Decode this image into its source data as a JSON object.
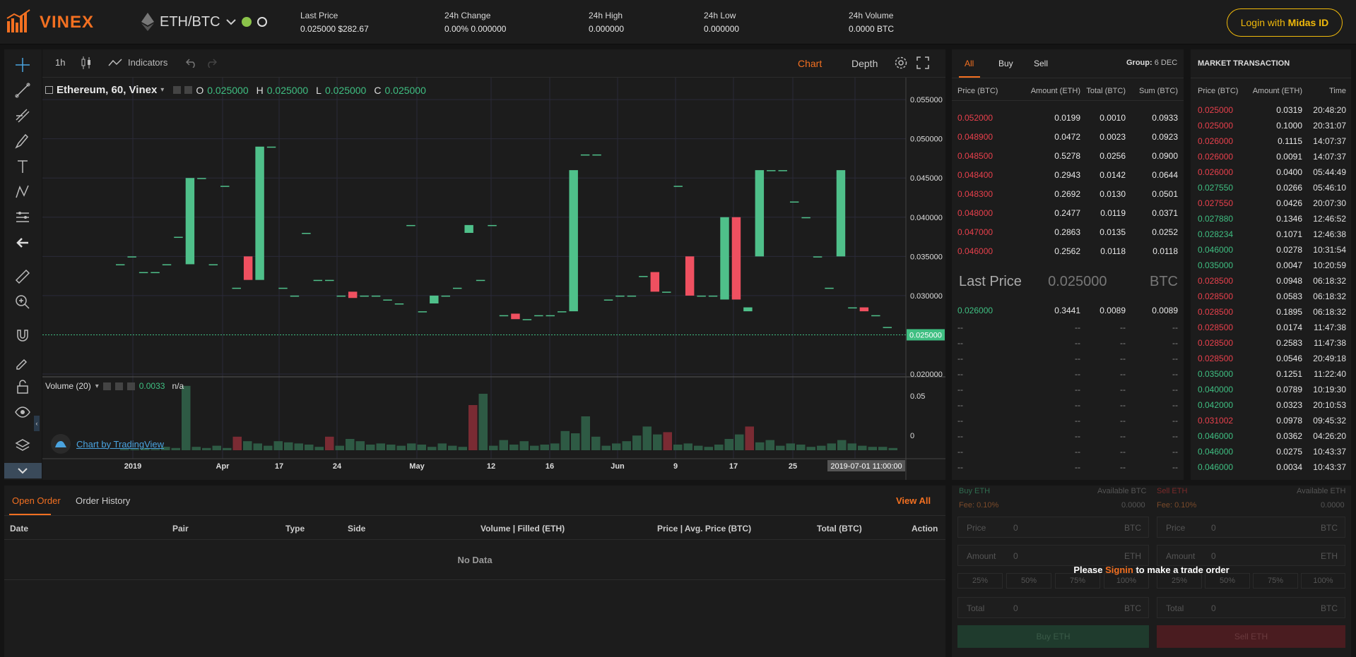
{
  "header": {
    "brand": "VINEX",
    "pair": "ETH/BTC",
    "stats": [
      {
        "label": "Last Price",
        "value": "0.025000 $282.67"
      },
      {
        "label": "24h Change",
        "value": "0.00% 0.000000"
      },
      {
        "label": "24h High",
        "value": "0.000000"
      },
      {
        "label": "24h Low",
        "value": "0.000000"
      },
      {
        "label": "24h Volume",
        "value": "0.0000 BTC"
      }
    ],
    "login_prefix": "Login with ",
    "login_brand": "Midas ID"
  },
  "chart_toolbar": {
    "interval": "1h",
    "indicators": "Indicators",
    "tab_chart": "Chart",
    "tab_depth": "Depth"
  },
  "chart": {
    "legend_title": "Ethereum, 60, Vinex",
    "o_label": "O",
    "o": "0.025000",
    "h_label": "H",
    "h": "0.025000",
    "l_label": "L",
    "l": "0.025000",
    "c_label": "C",
    "c": "0.025000",
    "volume_label": "Volume (20)",
    "volume_value": "0.0033",
    "volume_na": "n/a",
    "price_ticks": [
      "0.055000",
      "0.050000",
      "0.045000",
      "0.040000",
      "0.035000",
      "0.030000",
      "0.025000",
      "0.020000"
    ],
    "last_price_tag": "0.025000",
    "vol_ticks": [
      "0.05",
      "0"
    ],
    "x_ticks": [
      "2019",
      "Apr",
      "17",
      "24",
      "May",
      "12",
      "16",
      "Jun",
      "9",
      "17",
      "25"
    ],
    "crosshair_time": "2019-07-01 11:00:00",
    "watermark": "Chart by TradingView"
  },
  "chart_data": {
    "type": "bar",
    "title": "Ethereum, 60, Vinex",
    "ylim": [
      0.02,
      0.056
    ],
    "candles": [
      {
        "o": 0.034,
        "c": 0.034
      },
      {
        "o": 0.035,
        "c": 0.035
      },
      {
        "o": 0.033,
        "c": 0.033
      },
      {
        "o": 0.033,
        "c": 0.033
      },
      {
        "o": 0.034,
        "c": 0.034
      },
      {
        "o": 0.0375,
        "c": 0.0375
      },
      {
        "o": 0.034,
        "c": 0.045
      },
      {
        "o": 0.045,
        "c": 0.045
      },
      {
        "o": 0.034,
        "c": 0.034
      },
      {
        "o": 0.044,
        "c": 0.044
      },
      {
        "o": 0.031,
        "c": 0.031
      },
      {
        "o": 0.035,
        "c": 0.032
      },
      {
        "o": 0.032,
        "c": 0.049
      },
      {
        "o": 0.049,
        "c": 0.049
      },
      {
        "o": 0.031,
        "c": 0.031
      },
      {
        "o": 0.03,
        "c": 0.03
      },
      {
        "o": 0.038,
        "c": 0.038
      },
      {
        "o": 0.032,
        "c": 0.032
      },
      {
        "o": 0.032,
        "c": 0.032
      },
      {
        "o": 0.03,
        "c": 0.03
      },
      {
        "o": 0.0305,
        "c": 0.0297
      },
      {
        "o": 0.03,
        "c": 0.03
      },
      {
        "o": 0.03,
        "c": 0.03
      },
      {
        "o": 0.0295,
        "c": 0.0295
      },
      {
        "o": 0.029,
        "c": 0.029
      },
      {
        "o": 0.039,
        "c": 0.039
      },
      {
        "o": 0.028,
        "c": 0.028
      },
      {
        "o": 0.029,
        "c": 0.03
      },
      {
        "o": 0.03,
        "c": 0.03
      },
      {
        "o": 0.031,
        "c": 0.031
      },
      {
        "o": 0.038,
        "c": 0.039
      },
      {
        "o": 0.032,
        "c": 0.032
      },
      {
        "o": 0.039,
        "c": 0.039
      },
      {
        "o": 0.0275,
        "c": 0.0275
      },
      {
        "o": 0.0277,
        "c": 0.027
      },
      {
        "o": 0.027,
        "c": 0.027
      },
      {
        "o": 0.0275,
        "c": 0.0275
      },
      {
        "o": 0.0275,
        "c": 0.0275
      },
      {
        "o": 0.028,
        "c": 0.028
      },
      {
        "o": 0.028,
        "c": 0.046
      },
      {
        "o": 0.048,
        "c": 0.048
      },
      {
        "o": 0.048,
        "c": 0.048
      },
      {
        "o": 0.0295,
        "c": 0.0295
      },
      {
        "o": 0.03,
        "c": 0.03
      },
      {
        "o": 0.03,
        "c": 0.03
      },
      {
        "o": 0.0325,
        "c": 0.0325
      },
      {
        "o": 0.033,
        "c": 0.0305
      },
      {
        "o": 0.0305,
        "c": 0.0305
      },
      {
        "o": 0.044,
        "c": 0.044
      },
      {
        "o": 0.035,
        "c": 0.03
      },
      {
        "o": 0.03,
        "c": 0.03
      },
      {
        "o": 0.03,
        "c": 0.03
      },
      {
        "o": 0.0295,
        "c": 0.04
      },
      {
        "o": 0.04,
        "c": 0.0295
      },
      {
        "o": 0.028,
        "c": 0.0285
      },
      {
        "o": 0.035,
        "c": 0.046
      },
      {
        "o": 0.046,
        "c": 0.046
      },
      {
        "o": 0.046,
        "c": 0.046
      },
      {
        "o": 0.042,
        "c": 0.042
      },
      {
        "o": 0.04,
        "c": 0.04
      },
      {
        "o": 0.035,
        "c": 0.035
      },
      {
        "o": 0.031,
        "c": 0.031
      },
      {
        "o": 0.035,
        "c": 0.046
      },
      {
        "o": 0.0285,
        "c": 0.0285
      },
      {
        "o": 0.0285,
        "c": 0.028
      },
      {
        "o": 0.0275,
        "c": 0.0275
      },
      {
        "o": 0.026,
        "c": 0.026
      }
    ],
    "volumes": [
      0.001,
      0.001,
      0.002,
      0.001,
      0.003,
      0.002,
      0.057,
      0.003,
      0.002,
      0.004,
      0.002,
      0.012,
      0.008,
      0.006,
      0.004,
      0.008,
      0.007,
      0.006,
      0.005,
      0.003,
      0.012,
      0.004,
      0.01,
      0.008,
      0.005,
      0.006,
      0.005,
      0.004,
      0.006,
      0.005,
      0.003,
      0.006,
      0.004,
      0.003,
      0.04,
      0.05,
      0.004,
      0.009,
      0.005,
      0.008,
      0.004,
      0.005,
      0.006,
      0.017,
      0.015,
      0.03,
      0.012,
      0.004,
      0.006,
      0.008,
      0.013,
      0.021,
      0.014,
      0.016,
      0.005,
      0.006,
      0.004,
      0.003,
      0.005,
      0.01,
      0.014,
      0.021,
      0.007,
      0.009,
      0.004,
      0.006,
      0.005,
      0.003,
      0.004,
      0.006,
      0.009,
      0.006,
      0.004,
      0.003,
      0.003,
      0.002
    ]
  },
  "orderbook": {
    "tabs": [
      "All",
      "Buy",
      "Sell"
    ],
    "group_label": "Group:",
    "group_value": "6 DEC",
    "columns": [
      "Price (BTC)",
      "Amount (ETH)",
      "Total (BTC)",
      "Sum (BTC)"
    ],
    "asks": [
      [
        "0.052000",
        "0.0199",
        "0.0010",
        "0.0933"
      ],
      [
        "0.048900",
        "0.0472",
        "0.0023",
        "0.0923"
      ],
      [
        "0.048500",
        "0.5278",
        "0.0256",
        "0.0900"
      ],
      [
        "0.048400",
        "0.2943",
        "0.0142",
        "0.0644"
      ],
      [
        "0.048300",
        "0.2692",
        "0.0130",
        "0.0501"
      ],
      [
        "0.048000",
        "0.2477",
        "0.0119",
        "0.0371"
      ],
      [
        "0.047000",
        "0.2863",
        "0.0135",
        "0.0252"
      ],
      [
        "0.046000",
        "0.2562",
        "0.0118",
        "0.0118"
      ]
    ],
    "last_price_label": "Last Price",
    "last_price": "0.025000",
    "last_price_unit": "BTC",
    "bids": [
      [
        "0.026000",
        "0.3441",
        "0.0089",
        "0.0089"
      ]
    ],
    "placeholder": "--"
  },
  "market": {
    "title": "MARKET TRANSACTION",
    "columns": [
      "Price (BTC)",
      "Amount (ETH)",
      "Time"
    ],
    "rows": [
      [
        "0.025000",
        "0.0319",
        "20:48:20",
        "r"
      ],
      [
        "0.025000",
        "0.1000",
        "20:31:07",
        "r"
      ],
      [
        "0.026000",
        "0.1115",
        "14:07:37",
        "r"
      ],
      [
        "0.026000",
        "0.0091",
        "14:07:37",
        "r"
      ],
      [
        "0.026000",
        "0.0400",
        "05:44:49",
        "r"
      ],
      [
        "0.027550",
        "0.0266",
        "05:46:10",
        "g"
      ],
      [
        "0.027550",
        "0.0426",
        "20:07:30",
        "r"
      ],
      [
        "0.027880",
        "0.1346",
        "12:46:52",
        "g"
      ],
      [
        "0.028234",
        "0.1071",
        "12:46:38",
        "g"
      ],
      [
        "0.046000",
        "0.0278",
        "10:31:54",
        "g"
      ],
      [
        "0.035000",
        "0.0047",
        "10:20:59",
        "g"
      ],
      [
        "0.028500",
        "0.0948",
        "06:18:32",
        "r"
      ],
      [
        "0.028500",
        "0.0583",
        "06:18:32",
        "r"
      ],
      [
        "0.028500",
        "0.1895",
        "06:18:32",
        "r"
      ],
      [
        "0.028500",
        "0.0174",
        "11:47:38",
        "r"
      ],
      [
        "0.028500",
        "0.2583",
        "11:47:38",
        "r"
      ],
      [
        "0.028500",
        "0.0546",
        "20:49:18",
        "r"
      ],
      [
        "0.035000",
        "0.1251",
        "11:22:40",
        "g"
      ],
      [
        "0.040000",
        "0.0789",
        "10:19:30",
        "g"
      ],
      [
        "0.042000",
        "0.0323",
        "20:10:53",
        "g"
      ],
      [
        "0.031002",
        "0.0978",
        "09:45:32",
        "r"
      ],
      [
        "0.046000",
        "0.0362",
        "04:26:20",
        "g"
      ],
      [
        "0.046000",
        "0.0275",
        "10:43:37",
        "g"
      ],
      [
        "0.046000",
        "0.0034",
        "10:43:37",
        "g"
      ]
    ]
  },
  "orders": {
    "tab_open": "Open Order",
    "tab_history": "Order History",
    "view_all": "View All",
    "columns": [
      "Date",
      "Pair",
      "Type",
      "Side",
      "Volume | Filled (ETH)",
      "Price | Avg. Price (BTC)",
      "Total (BTC)",
      "Action"
    ],
    "empty": "No Data"
  },
  "trade": {
    "buy_title": "Buy ETH",
    "sell_title": "Sell ETH",
    "available_btc": "Available BTC",
    "available_eth": "Available ETH",
    "fee": "Fee: 0.10%",
    "balance": "0.0000",
    "price": "Price",
    "amount": "Amount",
    "total": "Total",
    "zero": "0",
    "unit_btc": "BTC",
    "unit_eth": "ETH",
    "pcts": [
      "25%",
      "50%",
      "75%",
      "100%"
    ],
    "please": "Please ",
    "signin": "Signin",
    "make_order": " to make a trade order",
    "buy_button": "Buy ETH",
    "sell_button": "Sell ETH"
  }
}
